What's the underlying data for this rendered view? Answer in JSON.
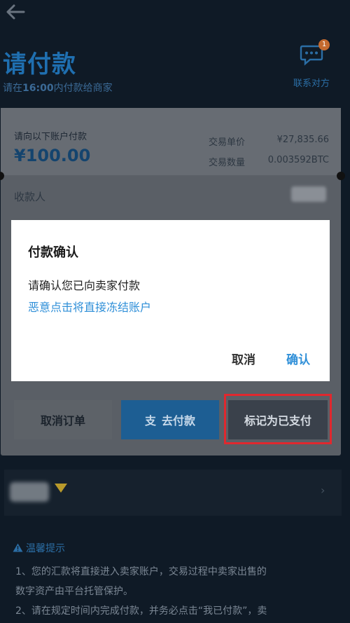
{
  "header": {
    "title": "请付款",
    "subtitle_prefix": "请在",
    "deadline": "16:00",
    "subtitle_suffix": "内付款给商家",
    "contact_label": "联系对方",
    "contact_badge": "1"
  },
  "payment": {
    "instruction": "请向以下账户付款",
    "amount": "¥100.00",
    "unit_price_label": "交易单价",
    "unit_price_value": "¥27,835.66",
    "quantity_label": "交易数量",
    "quantity_value": "0.003592BTC",
    "payee_label": "收款人"
  },
  "dialog": {
    "title": "付款确认",
    "message": "请确认您已向卖家付款",
    "warning": "恶意点击将直接冻结账户",
    "cancel_label": "取消",
    "confirm_label": "确认"
  },
  "actions": {
    "cancel_order": "取消订单",
    "go_pay": "去付款",
    "mark_paid": "标记为已支付"
  },
  "tips": {
    "title": "温馨提示",
    "lines": [
      "1、您的汇款将直接进入卖家账户，交易过程中卖家出售的",
      "数字资产由平台托管保护。",
      "2、请在规定时间内完成付款，并务必点击“我已付款”，卖"
    ]
  },
  "colors": {
    "background": "#0f1a26",
    "accent": "#2f8fd8",
    "highlight": "#e0282e"
  }
}
